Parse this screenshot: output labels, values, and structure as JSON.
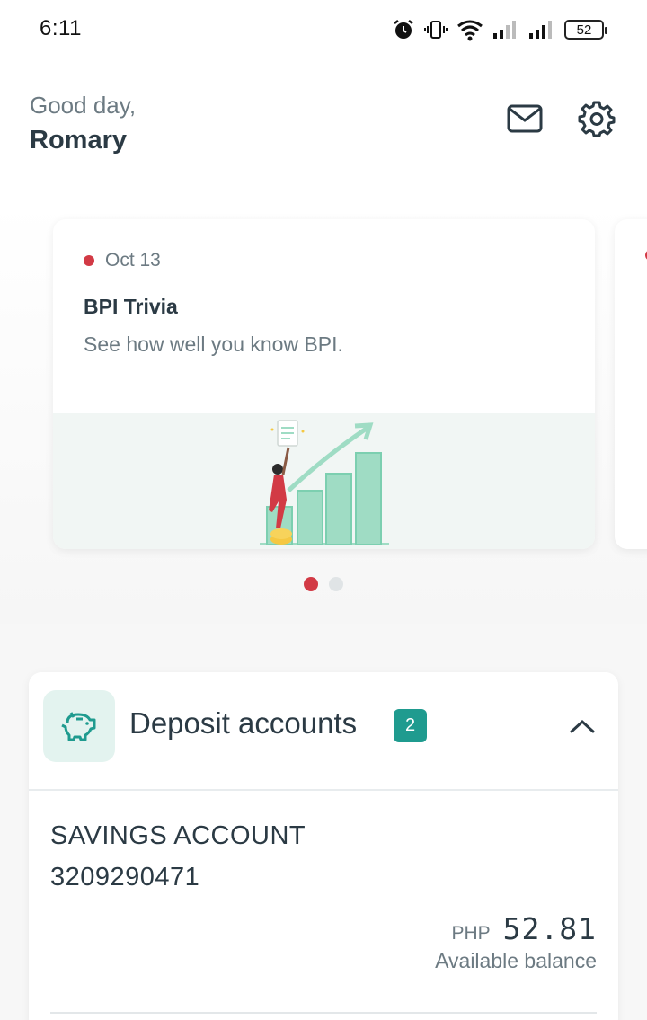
{
  "status_bar": {
    "time": "6:11",
    "battery": "52",
    "icons": [
      "alarm-icon",
      "vibrate-icon",
      "wifi-icon",
      "signal-icon",
      "signal-icon",
      "battery-icon"
    ]
  },
  "header": {
    "greeting": "Good day,",
    "name": "Romary",
    "icons": [
      "mail-icon",
      "gear-icon"
    ]
  },
  "carousel": {
    "cards": [
      {
        "date": "Oct 13",
        "title": "BPI Trivia",
        "description": "See how well you know BPI."
      }
    ],
    "active_index": 0,
    "page_count": 2
  },
  "deposit_accounts": {
    "title": "Deposit accounts",
    "count": "2",
    "accounts": [
      {
        "type": "SAVINGS ACCOUNT",
        "number": "3209290471",
        "currency": "PHP",
        "amount": "52.81",
        "balance_label": "Available balance"
      }
    ]
  },
  "colors": {
    "accent_red": "#d23a45",
    "accent_teal": "#1f9b8f",
    "text_dark": "#2b3a44",
    "text_muted": "#6c7a82"
  }
}
